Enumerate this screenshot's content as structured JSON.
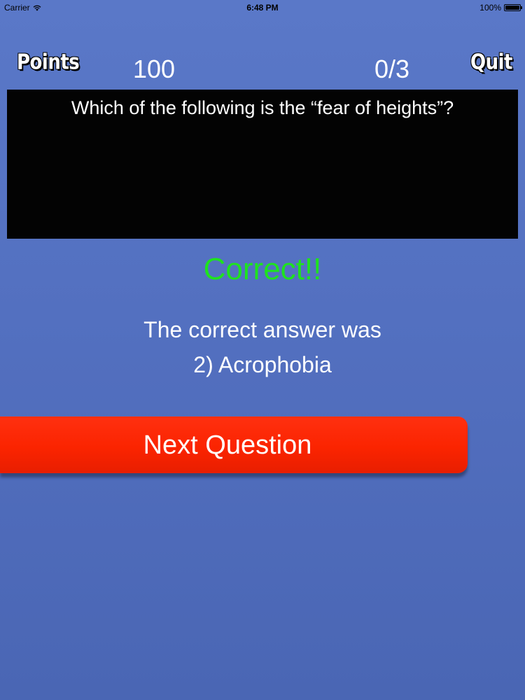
{
  "status_bar": {
    "carrier": "Carrier",
    "time": "6:48 PM",
    "battery_percent": "100%",
    "wifi_icon": "wifi-icon",
    "battery_icon": "battery-icon"
  },
  "header": {
    "points_label": "Points",
    "score": "100",
    "progress": "0/3",
    "quit_label": "Quit"
  },
  "question": {
    "text": "Which of the following is the “fear of heights”?"
  },
  "result": {
    "status": "Correct!!",
    "answer_intro": "The correct answer was",
    "answer": "2) Acrophobia"
  },
  "next_button": {
    "label": "Next Question"
  },
  "colors": {
    "background": "#5370c0",
    "question_panel": "#030303",
    "correct": "#1ee31e",
    "next_button": "#fb2400"
  }
}
